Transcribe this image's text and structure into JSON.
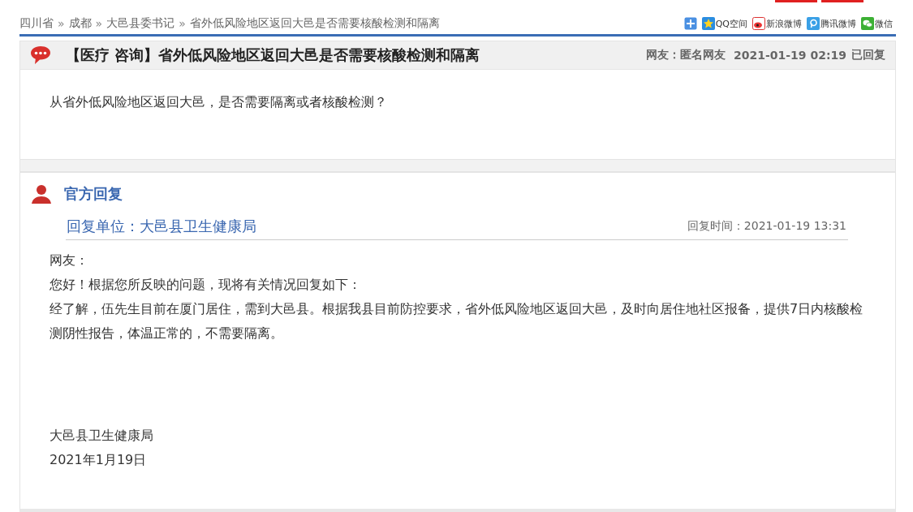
{
  "top_tabs": [
    {
      "kind": "red"
    },
    {
      "kind": "red"
    }
  ],
  "breadcrumb": {
    "separator": "»",
    "items": [
      "四川省",
      "成都",
      "大邑县委书记",
      "省外低风险地区返回大邑是否需要核酸检测和隔离"
    ]
  },
  "share": [
    {
      "kind": "add"
    },
    {
      "kind": "qzone",
      "label": "QQ空间"
    },
    {
      "kind": "weibo",
      "label": "新浪微博"
    },
    {
      "kind": "tencent",
      "label": "腾讯微博"
    },
    {
      "kind": "wechat",
      "label": "微信"
    }
  ],
  "question": {
    "title": "【医疗 咨询】省外低风险地区返回大邑是否需要核酸检测和隔离",
    "asker": "网友：匿名网友",
    "time": "2021-01-19 02:19",
    "status": "已回复",
    "body": "从省外低风险地区返回大邑，是否需要隔离或者核酸检测？"
  },
  "reply": {
    "heading": "官方回复",
    "unit": "回复单位：大邑县卫生健康局",
    "time": "回复时间：2021-01-19 13:31",
    "paragraphs": [
      "网友：",
      "您好！根据您所反映的问题，现将有关情况回复如下：",
      "经了解，伍先生目前在厦门居住，需到大邑县。根据我县目前防控要求，省外低风险地区返回大邑，及时向居住地社区报备，提供7日内核酸检测阴性报告，体温正常的，不需要隔离。"
    ],
    "signature": [
      "大邑县卫生健康局",
      "2021年1月19日"
    ]
  }
}
